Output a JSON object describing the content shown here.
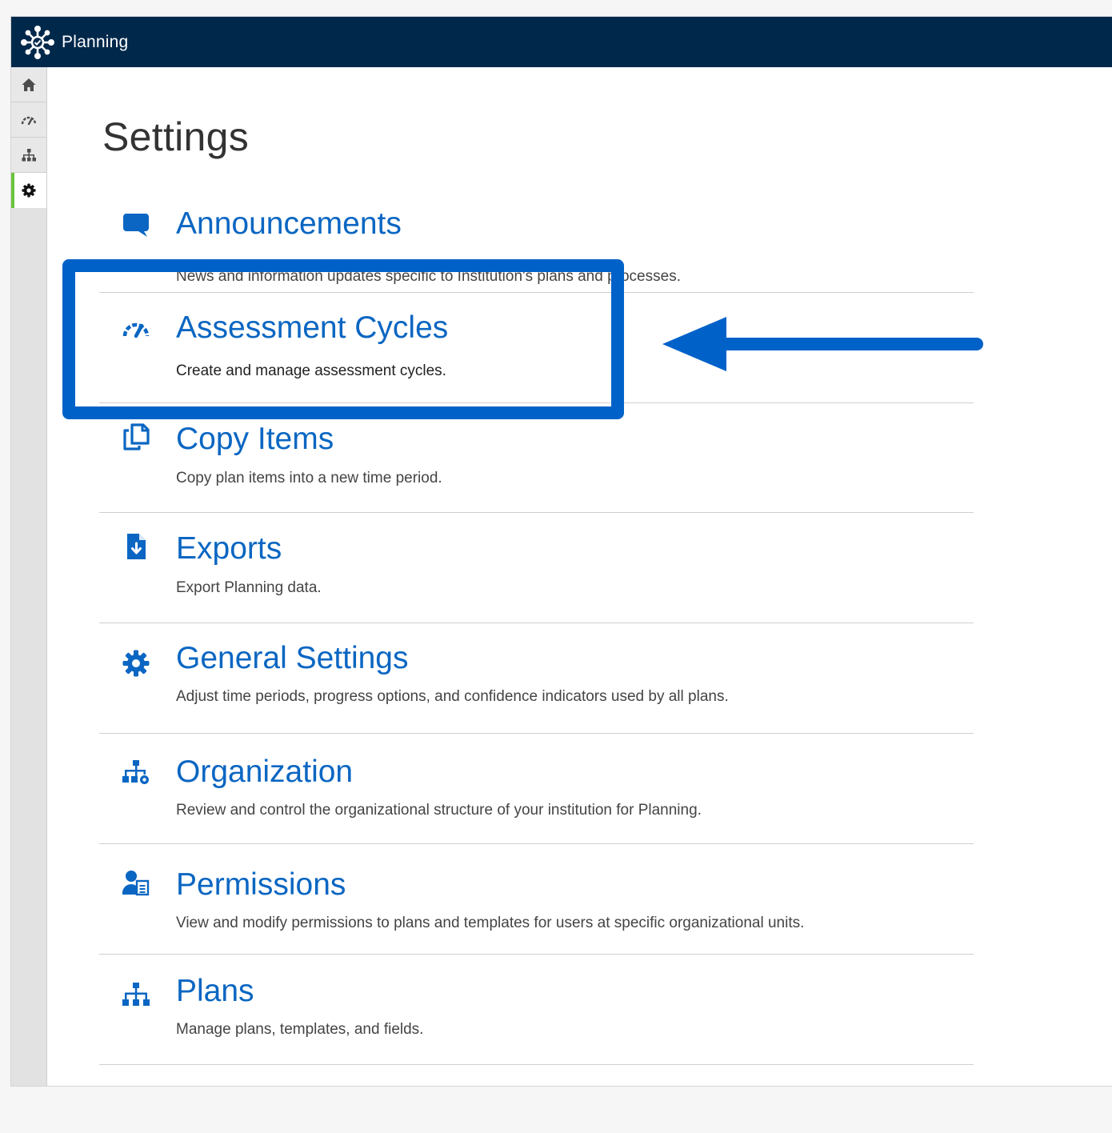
{
  "app": {
    "title": "Planning",
    "logo_icon": "network-hub-logo",
    "brand_color": "#00284b",
    "accent_color": "#6ac43b"
  },
  "sidebar": {
    "items": [
      {
        "icon": "home-icon",
        "active": false
      },
      {
        "icon": "gauge-icon",
        "active": false
      },
      {
        "icon": "org-chart-icon",
        "active": false
      },
      {
        "icon": "gear-icon",
        "active": true
      }
    ]
  },
  "page": {
    "title": "Settings"
  },
  "settings": {
    "items": [
      {
        "icon": "speech-bubble-icon",
        "title": "Announcements",
        "description": "News and information updates specific to Institution's plans and processes."
      },
      {
        "icon": "gauge-icon",
        "title": "Assessment Cycles",
        "description": "Create and manage assessment cycles."
      },
      {
        "icon": "copy-icon",
        "title": "Copy Items",
        "description": "Copy plan items into a new time period."
      },
      {
        "icon": "file-download-icon",
        "title": "Exports",
        "description": "Export Planning data."
      },
      {
        "icon": "gear-icon",
        "title": "General Settings",
        "description": "Adjust time periods, progress options, and confidence indicators used by all plans."
      },
      {
        "icon": "org-chart-gear-icon",
        "title": "Organization",
        "description": "Review and control the organizational structure of your institution for Planning."
      },
      {
        "icon": "user-document-icon",
        "title": "Permissions",
        "description": "View and modify permissions to plans and templates for users at specific organizational units."
      },
      {
        "icon": "org-chart-icon",
        "title": "Plans",
        "description": "Manage plans, templates, and fields."
      }
    ],
    "link_color": "#0a66c2"
  },
  "annotation": {
    "highlight_color": "#0062c9",
    "highlighted_item": "Assessment Cycles"
  }
}
